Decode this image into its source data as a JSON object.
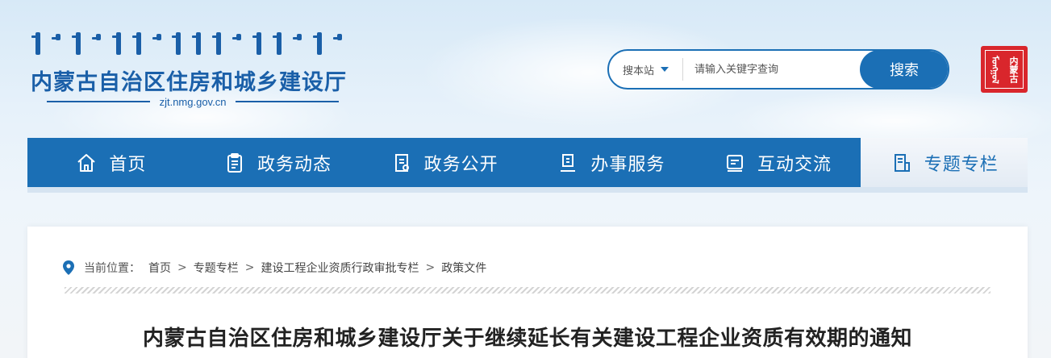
{
  "header": {
    "site_title": "内蒙古自治区住房和城乡建设厅",
    "domain": "zjt.nmg.gov.cn"
  },
  "search": {
    "scope_label": "搜本站",
    "placeholder": "请输入关键字查询",
    "button_label": "搜索"
  },
  "seal": {
    "text": [
      "内蒙古",
      "ᠮᠣᠩᠭᠣᠯ"
    ]
  },
  "nav": {
    "items": [
      {
        "label": "首页",
        "icon": "home-icon"
      },
      {
        "label": "政务动态",
        "icon": "clipboard-icon"
      },
      {
        "label": "政务公开",
        "icon": "document-list-icon"
      },
      {
        "label": "办事服务",
        "icon": "service-icon"
      },
      {
        "label": "互动交流",
        "icon": "chat-icon"
      },
      {
        "label": "专题专栏",
        "icon": "topic-icon"
      }
    ],
    "active_index": 5
  },
  "breadcrumb": {
    "prefix": "当前位置：",
    "items": [
      "首页",
      "专题专栏",
      "建设工程企业资质行政审批专栏",
      "政策文件"
    ],
    "separator": ">"
  },
  "article": {
    "title": "内蒙古自治区住房和城乡建设厅关于继续延长有关建设工程企业资质有效期的通知"
  },
  "colors": {
    "primary": "#1b6fb5",
    "seal_red": "#d9262c",
    "title_blue": "#1a5fa8"
  }
}
